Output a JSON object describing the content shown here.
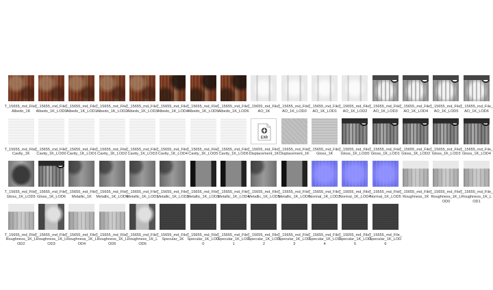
{
  "files": [
    {
      "name": "T_15655_md_File_Albedo_1K",
      "kind": "albedo"
    },
    {
      "name": "T_15655_md_File_Albedo_1K_LOD0",
      "kind": "albedo"
    },
    {
      "name": "T_15655_md_File_Albedo_1K_LOD1",
      "kind": "albedo"
    },
    {
      "name": "T_15655_md_File_Albedo_1K_LOD2",
      "kind": "albedo"
    },
    {
      "name": "T_15655_md_File_Albedo_1K_LOD3",
      "kind": "albedo"
    },
    {
      "name": "T_15655_md_File_Albedo_1K_LOD4",
      "kind": "albedo-dark"
    },
    {
      "name": "T_15655_md_File_Albedo_1K_LOD5",
      "kind": "albedo-dark"
    },
    {
      "name": "T_15655_md_File_Albedo_1K_LOD6",
      "kind": "albedo-dark"
    },
    {
      "name": "T_15655_md_File_AO_1K",
      "kind": "ao"
    },
    {
      "name": "T_15655_md_File_AO_1K_LOD0",
      "kind": "ao"
    },
    {
      "name": "T_15655_md_File_AO_1K_LOD1",
      "kind": "ao"
    },
    {
      "name": "T_15655_md_File_AO_1K_LOD2",
      "kind": "ao"
    },
    {
      "name": "T_15655_md_File_AO_1K_LOD3",
      "kind": "ao-busy"
    },
    {
      "name": "T_15655_md_File_AO_1K_LOD4",
      "kind": "ao-busy"
    },
    {
      "name": "T_15655_md_File_AO_1K_LOD5",
      "kind": "ao-busy"
    },
    {
      "name": "T_15655_md_File_AO_1K_LOD6",
      "kind": "ao-busy"
    },
    {
      "name": "T_15655_md_File_Cavity_1K",
      "kind": "cavity"
    },
    {
      "name": "T_15655_md_File_Cavity_1K_LOD0",
      "kind": "cavity"
    },
    {
      "name": "T_15655_md_File_Cavity_1K_LOD1",
      "kind": "cavity"
    },
    {
      "name": "T_15655_md_File_Cavity_1K_LOD2",
      "kind": "cavity"
    },
    {
      "name": "T_15655_md_File_Cavity_1K_LOD3",
      "kind": "cavity"
    },
    {
      "name": "T_15655_md_File_Cavity_1K_LOD4",
      "kind": "cavity"
    },
    {
      "name": "T_15655_md_File_Cavity_1K_LOD5",
      "kind": "cavity"
    },
    {
      "name": "T_15655_md_File_Cavity_1K_LOD6",
      "kind": "cavity"
    },
    {
      "name": "T_15655_md_File_Displacement_1K",
      "kind": "exr",
      "badge": "EXR"
    },
    {
      "name": "T_15655_md_File_Displacement_1K",
      "kind": "disp"
    },
    {
      "name": "T_15655_md_File_Gloss_1K",
      "kind": "gloss-light"
    },
    {
      "name": "T_15655_md_File_Gloss_1K_LOD0",
      "kind": "gloss"
    },
    {
      "name": "T_15655_md_File_Gloss_1K_LOD1",
      "kind": "gloss"
    },
    {
      "name": "T_15655_md_File_Gloss_1K_LOD2",
      "kind": "gloss"
    },
    {
      "name": "T_15655_md_File_Gloss_1K_LOD3",
      "kind": "gloss"
    },
    {
      "name": "T_15655_md_File_Gloss_1K_LOD4",
      "kind": "gloss"
    },
    {
      "name": "T_15655_md_File_Gloss_1K_LOD5",
      "kind": "gloss-mid"
    },
    {
      "name": "T_15655_md_File_Gloss_1K_LOD6",
      "kind": "gloss"
    },
    {
      "name": "T_15655_md_File_Metallic_1K",
      "kind": "metal"
    },
    {
      "name": "T_15655_md_File_Metallic_1K_LOD0",
      "kind": "metal"
    },
    {
      "name": "T_15655_md_File_Metallic_1K_LOD1",
      "kind": "metal"
    },
    {
      "name": "T_15655_md_File_Metallic_1K_LOD2",
      "kind": "metal"
    },
    {
      "name": "T_15655_md_File_Metallic_1K_LOD3",
      "kind": "metal-dark"
    },
    {
      "name": "T_15655_md_File_Metallic_1K_LOD4",
      "kind": "metal-dark"
    },
    {
      "name": "T_15655_md_File_Metallic_1K_LOD5",
      "kind": "metal"
    },
    {
      "name": "T_15655_md_File_Metallic_1K_LOD6",
      "kind": "metal-dark"
    },
    {
      "name": "T_15655_md_File_Normal_1K_LOD3",
      "kind": "normal"
    },
    {
      "name": "T_15655_md_File_Normal_1K_LOD4",
      "kind": "normal"
    },
    {
      "name": "T_15655_md_File_Normal_1K_LOD5",
      "kind": "normal"
    },
    {
      "name": "T_15655_md_File_Roughness_1K",
      "kind": "rough"
    },
    {
      "name": "T_15655_md_File_Roughness_1K_LOD0",
      "kind": "rough"
    },
    {
      "name": "T_15655_md_File_Roughness_1K_LOD1",
      "kind": "rough"
    },
    {
      "name": "T_15655_md_File_Roughness_1K_LOD2",
      "kind": "rough"
    },
    {
      "name": "T_15655_md_File_Roughness_1K_LOD3",
      "kind": "rough-dark"
    },
    {
      "name": "T_15655_md_File_Roughness_1K_LOD4",
      "kind": "rough"
    },
    {
      "name": "T_15655_md_File_Roughness_1K_LOD5",
      "kind": "rough"
    },
    {
      "name": "T_15655_md_File_Roughness_1K_LOD6",
      "kind": "rough-dark"
    },
    {
      "name": "T_15655_md_File_Specular_1K",
      "kind": "spec"
    },
    {
      "name": "T_15655_md_File_Specular_1K_LOD0",
      "kind": "spec"
    },
    {
      "name": "T_15655_md_File_Specular_1K_LOD1",
      "kind": "spec"
    },
    {
      "name": "T_15655_md_File_Specular_1K_LOD2",
      "kind": "spec"
    },
    {
      "name": "T_15655_md_File_Specular_1K_LOD3",
      "kind": "spec"
    },
    {
      "name": "T_15655_md_File_Specular_1K_LOD4",
      "kind": "spec"
    },
    {
      "name": "T_15655_md_File_Specular_1K_LOD5",
      "kind": "spec"
    },
    {
      "name": "T_15655_md_File_Specular_1K_LOD6",
      "kind": "spec"
    }
  ]
}
